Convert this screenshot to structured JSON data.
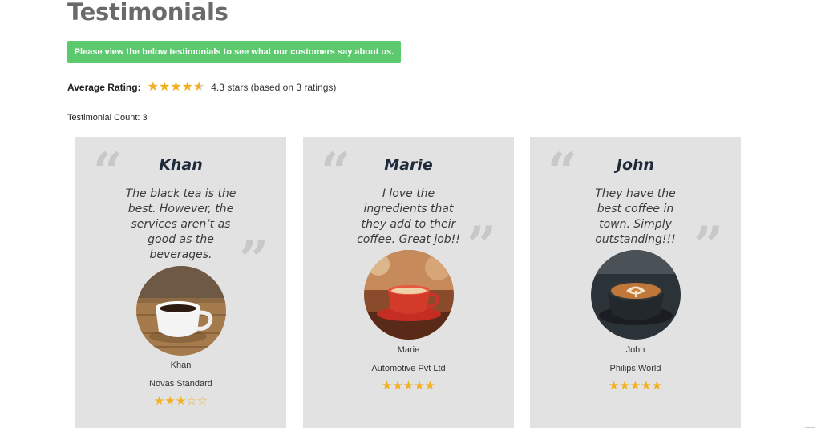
{
  "page": {
    "title": "Testimonials",
    "notice": "Please view the below testimonials to see what our customers say about us.",
    "average_label": "Average Rating:",
    "average_rating": 4.3,
    "average_text": "4.3 stars (based on 3 ratings)",
    "count_text": "Testimonial Count: 3"
  },
  "colors": {
    "accent_green": "#5cc96e",
    "star": "#f2b01e",
    "card_bg": "#e2e2e2"
  },
  "testimonials": [
    {
      "name": "Khan",
      "quote": "The black tea is the best. However, the services aren’t as good as the beverages.",
      "author": "Khan",
      "company": "Novas Standard",
      "rating": 3,
      "photo": "white-coffee-cup-on-wood"
    },
    {
      "name": "Marie",
      "quote": "I love the ingredients that they add to their coffee. Great job!!",
      "author": "Marie",
      "company": "Automotive Pvt Ltd",
      "rating": 5,
      "photo": "red-coffee-cup"
    },
    {
      "name": "John",
      "quote": "They have the best coffee in town. Simply outstanding!!!",
      "author": "John",
      "company": "Philips World",
      "rating": 5,
      "photo": "latte-art-cup"
    }
  ]
}
